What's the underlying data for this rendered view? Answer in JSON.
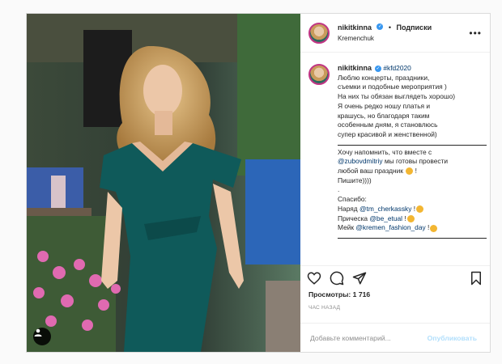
{
  "post": {
    "username": "nikitkinna",
    "follow_label": "Подписки",
    "separator": "•",
    "location": "Kremenchuk",
    "hashtag": "#kfd2020",
    "caption_lines": [
      "Люблю концерты, праздники,",
      "съемки и подобные мероприятия )",
      "На них ты обязан выглядеть хорошо)",
      "Я очень редко ношу платья и",
      "крашусь, но благодаря таким",
      "особенным дням, я становлюсь",
      "супер красивой и женственной)"
    ],
    "caption_lines_2": [
      "Хочу напомнить, что вместе с",
      "любой ваш праздник",
      "Пишите))))"
    ],
    "mention_zubov": "@zubovdmitriy",
    "text_we_ready": " мы готовы провести",
    "exclaim": "!",
    "dot_line": ".",
    "thanks": "Спасибо:",
    "credit_outfit_label": "Наряд ",
    "credit_outfit_mention": "@tm_cherkassky",
    "credit_hair_label": "Прическа ",
    "credit_hair_mention": "@be_etual",
    "credit_makeup_label": "Мейк ",
    "credit_makeup_mention": "@kremen_fashion_day"
  },
  "stats": {
    "views_label": "Просмотры:",
    "views_count": "1 716",
    "time": "ЧАС НАЗАД"
  },
  "comment": {
    "placeholder": "Добавьте комментарий...",
    "publish_label": "Опубликовать"
  },
  "icons": {
    "like": "heart-icon",
    "comment": "comment-icon",
    "share": "paper-plane-icon",
    "save": "bookmark-icon",
    "more": "more-options-icon",
    "tag": "user-tag-icon",
    "verified": "verified-badge-icon"
  },
  "colors": {
    "link": "#00376b",
    "verified": "#3897f0",
    "publish_disabled": "#b2dffc",
    "dress": "#0f5a5a"
  }
}
